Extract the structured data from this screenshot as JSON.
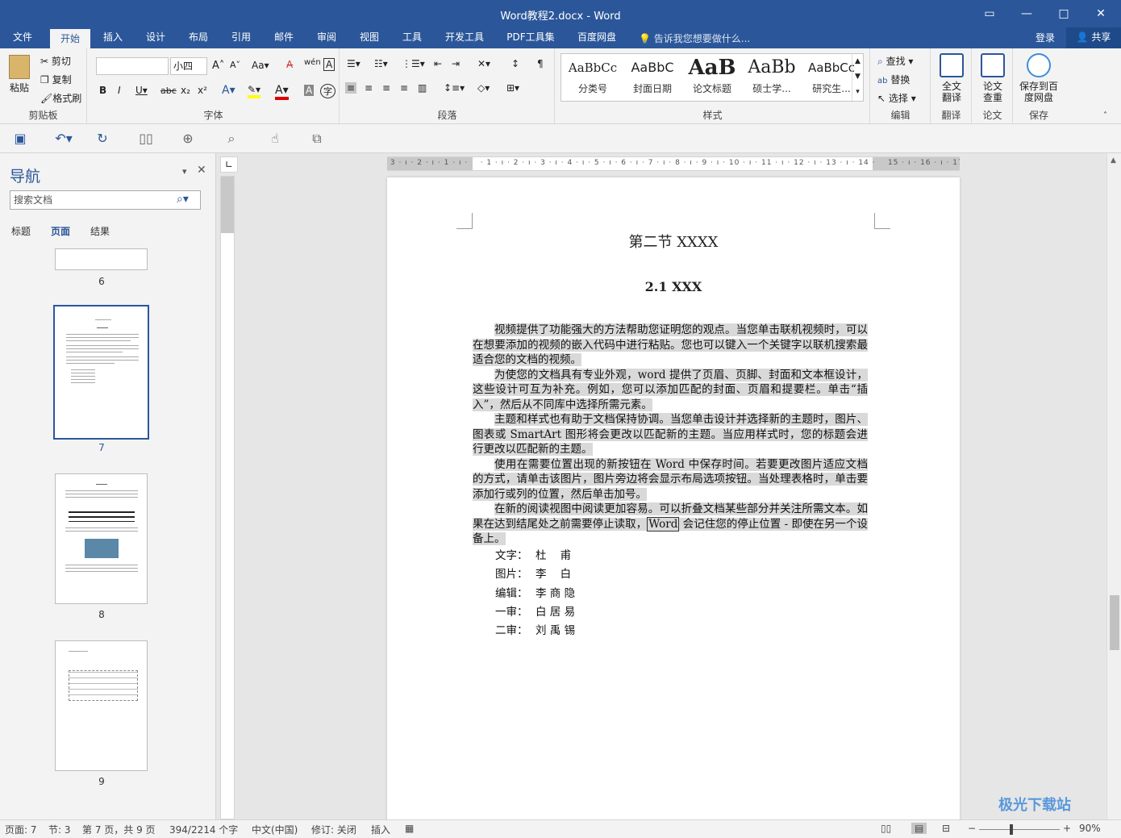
{
  "window": {
    "title": "Word教程2.docx - Word"
  },
  "menu": {
    "tabs": [
      "文件",
      "开始",
      "插入",
      "设计",
      "布局",
      "引用",
      "邮件",
      "审阅",
      "视图",
      "工具",
      "开发工具",
      "PDF工具集",
      "百度网盘"
    ],
    "active": "开始",
    "tell_me": "告诉我您想要做什么...",
    "login": "登录",
    "share": "共享"
  },
  "ribbon": {
    "clipboard": {
      "paste": "粘贴",
      "cut": "剪切",
      "copy": "复制",
      "format_painter": "格式刷",
      "label": "剪贴板"
    },
    "font": {
      "font_name": "",
      "font_size": "小四",
      "case": "Aa",
      "label": "字体"
    },
    "paragraph": {
      "label": "段落"
    },
    "styles": {
      "items": [
        {
          "sample": "AaBbCc",
          "name": "分类号"
        },
        {
          "sample": "AaBbC",
          "name": "封面日期"
        },
        {
          "sample": "AaB",
          "name": "论文标题"
        },
        {
          "sample": "AaBb",
          "name": "硕士学..."
        },
        {
          "sample": "AaBbCc",
          "name": "研究生..."
        }
      ],
      "label": "样式"
    },
    "editing": {
      "find": "查找",
      "replace": "替换",
      "select": "选择",
      "label": "编辑"
    },
    "translate": {
      "btn": "全文翻译",
      "label": "翻译"
    },
    "paper": {
      "btn": "论文查重",
      "label": "论文"
    },
    "save": {
      "btn": "保存到百度网盘",
      "label": "保存"
    }
  },
  "nav": {
    "title": "导航",
    "search_placeholder": "搜索文档",
    "tabs": [
      "标题",
      "页面",
      "结果"
    ],
    "active_tab": "页面",
    "pages": [
      "6",
      "7",
      "8",
      "9"
    ],
    "selected_page": "7"
  },
  "document": {
    "title": "第二节  XXXX",
    "subtitle": "2.1 XXX",
    "paragraphs": [
      "视频提供了功能强大的方法帮助您证明您的观点。当您单击联机视频时，可以在想要添加的视频的嵌入代码中进行粘贴。您也可以键入一个关键字以联机搜索最适合您的文档的视频。",
      "为使您的文档具有专业外观，word 提供了页眉、页脚、封面和文本框设计，这些设计可互为补充。例如，您可以添加匹配的封面、页眉和提要栏。单击“插入”，然后从不同库中选择所需元素。",
      "主题和样式也有助于文档保持协调。当您单击设计并选择新的主题时，图片、图表或 SmartArt 图形将会更改以匹配新的主题。当应用样式时，您的标题会进行更改以匹配新的主题。",
      "使用在需要位置出现的新按钮在 Word 中保存时间。若要更改图片适应文档的方式，请单击该图片，图片旁边将会显示布局选项按钮。当处理表格时，单击要添加行或列的位置，然后单击加号。"
    ],
    "last_para_a": "在新的阅读视图中阅读更加容易。可以折叠文档某些部分并关注所需文本。如果在达到结尾处之前需要停止读取，",
    "last_para_word": "Word",
    "last_para_b": " 会记住您的停止位置 - 即使在另一个设备上。",
    "credits": [
      {
        "k": "文字：",
        "v": "杜    甫"
      },
      {
        "k": "图片：",
        "v": "李    白"
      },
      {
        "k": "编辑：",
        "v": "李 商 隐"
      },
      {
        "k": "一审：",
        "v": "白 居 易"
      },
      {
        "k": "二审：",
        "v": "刘 禹 锡"
      }
    ]
  },
  "status": {
    "page": "页面: 7",
    "section": "节: 3",
    "page_of": "第 7 页，共 9 页",
    "words": "394/2214 个字",
    "language": "中文(中国)",
    "track": "修订: 关闭",
    "mode": "插入",
    "zoom": "90%"
  },
  "watermark": "极光下载站"
}
